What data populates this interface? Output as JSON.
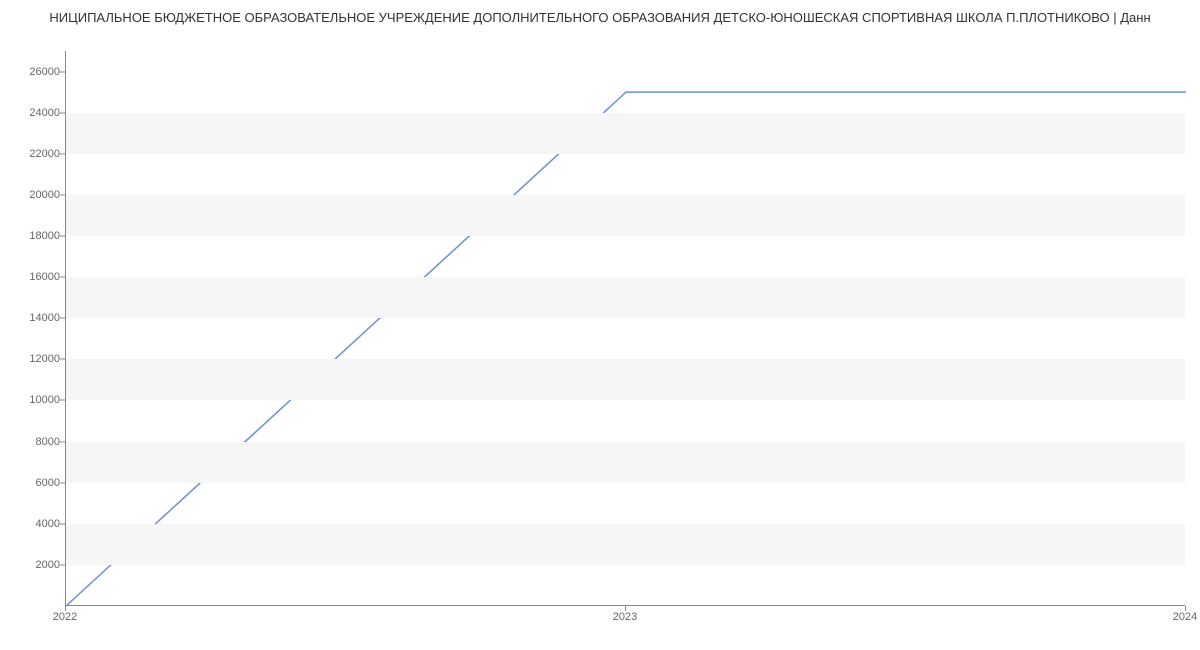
{
  "title": "НИЦИПАЛЬНОЕ БЮДЖЕТНОЕ ОБРАЗОВАТЕЛЬНОЕ УЧРЕЖДЕНИЕ ДОПОЛНИТЕЛЬНОГО ОБРАЗОВАНИЯ ДЕТСКО-ЮНОШЕСКАЯ СПОРТИВНАЯ ШКОЛА П.ПЛОТНИКОВО | Данн",
  "chart_data": {
    "type": "line",
    "x": [
      2022,
      2023,
      2024
    ],
    "values": [
      0,
      25000,
      25000
    ],
    "xlabel": "",
    "ylabel": "",
    "x_ticks": [
      2022,
      2023,
      2024
    ],
    "y_ticks": [
      2000,
      4000,
      6000,
      8000,
      10000,
      12000,
      14000,
      16000,
      18000,
      20000,
      22000,
      24000,
      26000
    ],
    "xlim": [
      2022,
      2024
    ],
    "ylim": [
      0,
      27000
    ],
    "line_color": "#6b8fd4"
  }
}
